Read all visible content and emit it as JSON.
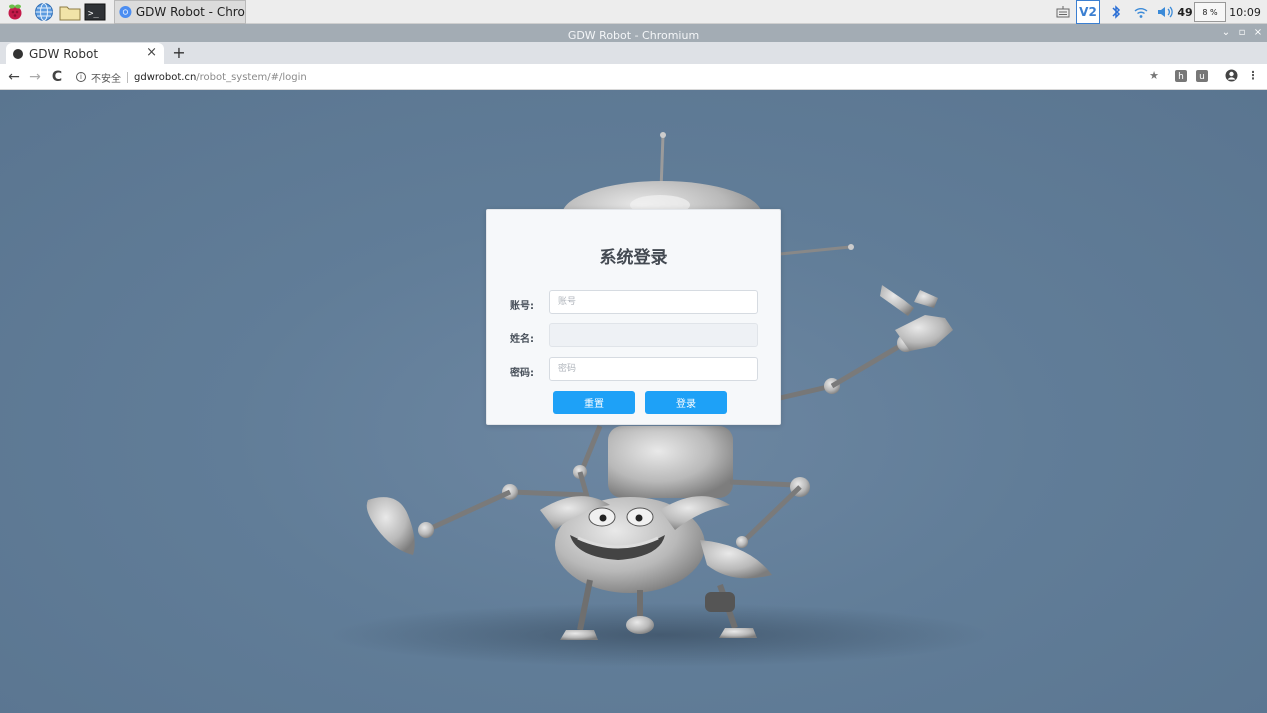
{
  "taskbar": {
    "launchers": [
      "raspberry-menu-icon",
      "web-browser-icon",
      "file-manager-icon",
      "terminal-icon"
    ],
    "task_label": "GDW Robot - Chromi…",
    "tray": {
      "vnc_label": "V2",
      "volume_value": "49",
      "cpu_label": "8 %",
      "clock": "10:09"
    }
  },
  "window": {
    "title": "GDW Robot - Chromium",
    "controls": [
      "⌄",
      "▫",
      "×"
    ]
  },
  "tab": {
    "title": "GDW Robot",
    "close": "×",
    "new_tab": "+"
  },
  "toolbar": {
    "back": "←",
    "forward": "→",
    "reload": "C",
    "security_label": "不安全",
    "url_host": "gdwrobot.cn",
    "url_path": "/robot_system/#/login",
    "star": "★",
    "ext1": "h",
    "ext2": "u",
    "menu": "⋮"
  },
  "login": {
    "title": "系统登录",
    "account_label": "账号:",
    "account_placeholder": "账号",
    "account_value": "",
    "name_label": "姓名:",
    "name_value": "",
    "password_label": "密码:",
    "password_placeholder": "密码",
    "password_value": "",
    "reset_button": "重置",
    "login_button": "登录"
  },
  "colors": {
    "page_background": "#5f7a95",
    "button": "#1ea1f7",
    "card": "#f6f8fa"
  }
}
